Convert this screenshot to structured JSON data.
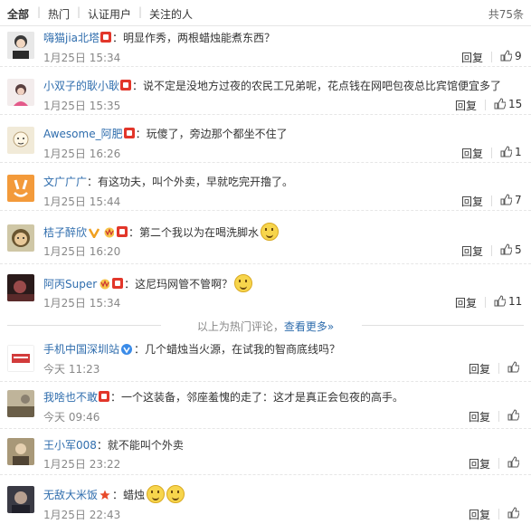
{
  "tabs": [
    "全部",
    "热门",
    "认证用户",
    "关注的人"
  ],
  "total": "共75条",
  "more_text": "以上为热门评论，",
  "more_link": "查看更多»",
  "reply_label": "回复",
  "hot_comments": [
    {
      "user": "嗨猫jia北塔",
      "text": "：明显作秀，两根蜡烛能煮东西？",
      "time": "1月25日 15:34",
      "likes": "9",
      "avatar_color": "#c8c8c8"
    },
    {
      "user": "小双子的耿小耿",
      "text": "：说不定是没地方过夜的农民工兄弟呢，花点钱在网吧包夜总比宾馆便宜多了",
      "time": "1月25日 15:35",
      "likes": "15",
      "avatar_color": "#d9c3c3"
    },
    {
      "user": "Awesome_阿肥",
      "text": "：玩傻了，旁边那个都坐不住了",
      "time": "1月25日 16:26",
      "likes": "1",
      "avatar_color": "#e6ddc8"
    },
    {
      "user": "文广广广",
      "text": "：有这功夫，叫个外卖，早就吃完开撸了。",
      "time": "1月25日 15:44",
      "likes": "7",
      "avatar_color": "#f39a3a"
    },
    {
      "user": "桔子醉欣",
      "text": "：第二个我以为在喝洗脚水",
      "time": "1月25日 16:20",
      "likes": "5",
      "avatar_color": "#6b7a5a"
    },
    {
      "user": "阿丙Super",
      "text": "：这尼玛网管不管啊？",
      "time": "1月25日 15:34",
      "likes": "11",
      "avatar_color": "#5a3a3a"
    }
  ],
  "recent_comments": [
    {
      "user": "手机中国深圳站",
      "text": "：几个蜡烛当火源，在试我的智商底线吗？",
      "time": "今天 11:23",
      "avatar_color": "#d23b3b"
    },
    {
      "user": "我啥也不敢",
      "text": "：一个这装备，邻座羞愧的走了：这才是真正会包夜的高手。",
      "time": "今天 09:46",
      "avatar_color": "#7a6e58"
    },
    {
      "user": "王小军008",
      "text": "：就不能叫个外卖",
      "time": "1月25日 23:22",
      "avatar_color": "#8a7a62"
    },
    {
      "user": "无敌大米饭",
      "text": "：蜡烛",
      "time": "1月25日 22:43",
      "avatar_color": "#4a4a52"
    }
  ]
}
